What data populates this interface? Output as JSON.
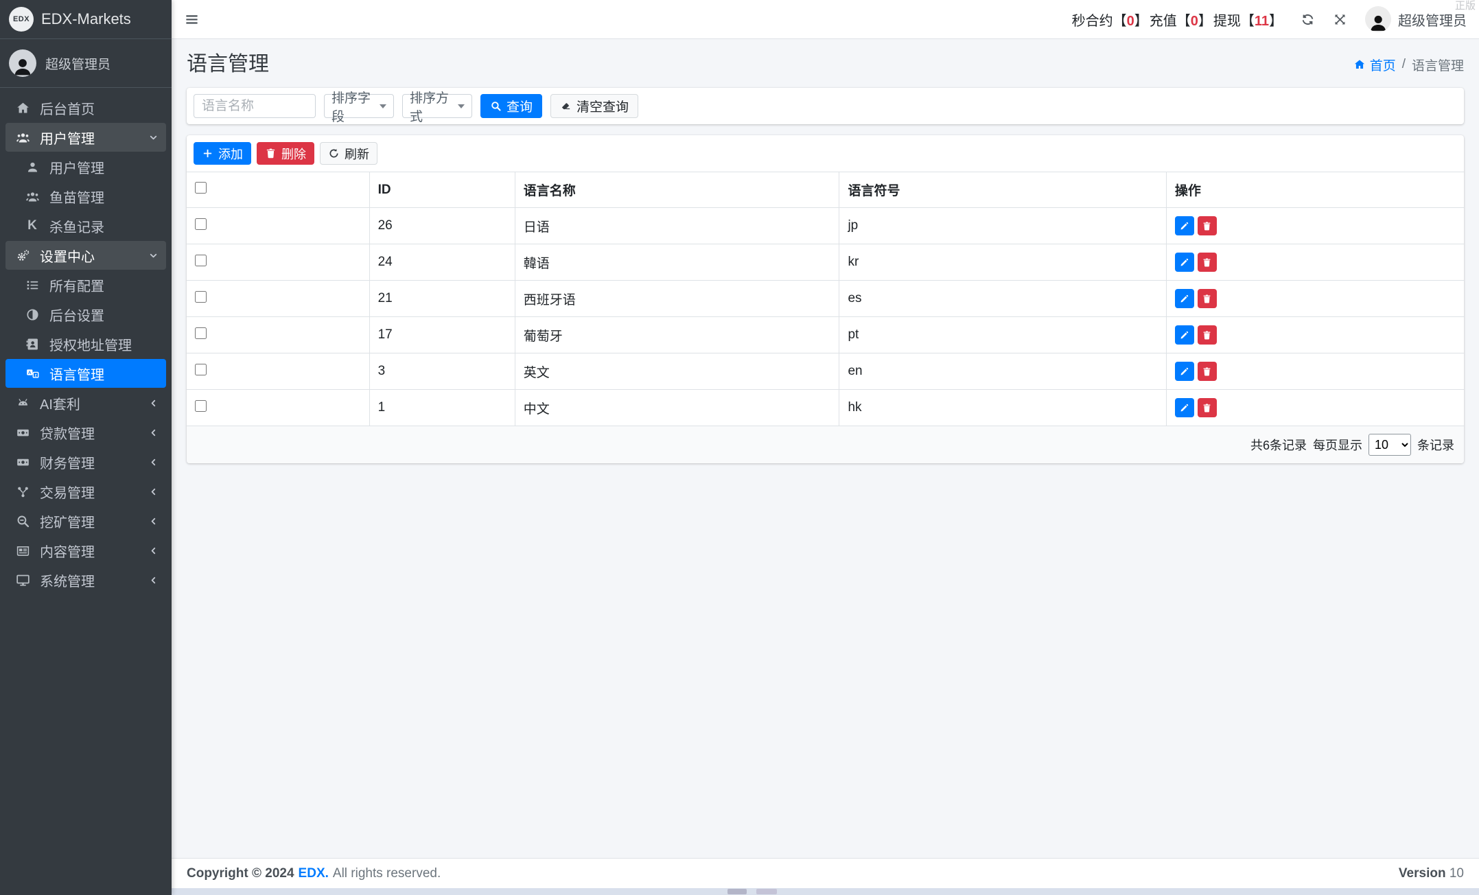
{
  "colors": {
    "accent": "#007bff",
    "danger": "#dc3545",
    "sidebar_bg": "#343a40"
  },
  "brand": {
    "logo_text": "EDX",
    "name": "EDX-Markets"
  },
  "user_panel": {
    "name": "超级管理员"
  },
  "sidebar": {
    "items": [
      {
        "label": "后台首页"
      },
      {
        "label": "用户管理",
        "state": "expanded",
        "children": [
          {
            "label": "用户管理"
          },
          {
            "label": "鱼苗管理"
          },
          {
            "label": "杀鱼记录"
          }
        ]
      },
      {
        "label": "设置中心",
        "state": "expanded",
        "children": [
          {
            "label": "所有配置"
          },
          {
            "label": "后台设置"
          },
          {
            "label": "授权地址管理"
          },
          {
            "label": "语言管理",
            "active": true
          }
        ]
      },
      {
        "label": "AI套利"
      },
      {
        "label": "贷款管理"
      },
      {
        "label": "财务管理"
      },
      {
        "label": "交易管理"
      },
      {
        "label": "挖矿管理"
      },
      {
        "label": "内容管理"
      },
      {
        "label": "系统管理"
      }
    ]
  },
  "topbar": {
    "watermark": "正版",
    "stats": [
      {
        "prefix": "秒合约【",
        "value": "0",
        "suffix": "】"
      },
      {
        "prefix": "充值【",
        "value": "0",
        "suffix": "】"
      },
      {
        "prefix": "提现【",
        "value": "11",
        "suffix": "】"
      }
    ],
    "username": "超级管理员"
  },
  "page": {
    "title": "语言管理",
    "breadcrumb_home": "首页",
    "breadcrumb_sep": "/",
    "breadcrumb_current": "语言管理"
  },
  "filters": {
    "name_placeholder": "语言名称",
    "sort_field_label": "排序字段",
    "sort_order_label": "排序方式",
    "search_label": "查询",
    "clear_label": "清空查询"
  },
  "toolbar": {
    "add_label": "添加",
    "delete_label": "删除",
    "refresh_label": "刷新"
  },
  "table": {
    "columns": {
      "id": "ID",
      "name": "语言名称",
      "code": "语言符号",
      "actions": "操作"
    },
    "rows": [
      {
        "id": "26",
        "name": "日语",
        "code": "jp"
      },
      {
        "id": "24",
        "name": "韓语",
        "code": "kr"
      },
      {
        "id": "21",
        "name": "西班牙语",
        "code": "es"
      },
      {
        "id": "17",
        "name": "葡萄牙",
        "code": "pt"
      },
      {
        "id": "3",
        "name": "英文",
        "code": "en"
      },
      {
        "id": "1",
        "name": "中文",
        "code": "hk"
      }
    ]
  },
  "pagination": {
    "total_text": "共6条记录",
    "per_page_label": "每页显示",
    "per_page": "10",
    "unit_label": "条记录"
  },
  "footer": {
    "copyright": "Copyright © 2024",
    "brand": "EDX.",
    "rights": "All rights reserved.",
    "version_label": "Version",
    "version_value": "10"
  }
}
